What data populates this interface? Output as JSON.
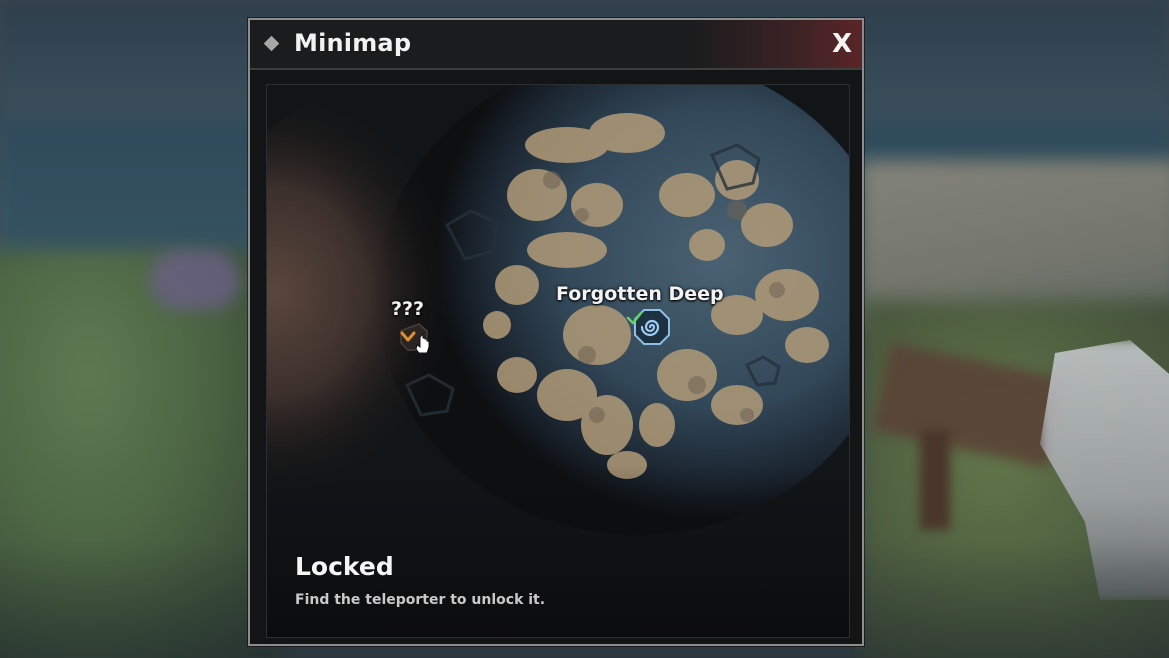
{
  "window": {
    "title": "Minimap",
    "close_label": "X"
  },
  "map": {
    "markers": [
      {
        "label": "???",
        "icon": "chevron-down-icon",
        "state": "locked",
        "color": "#e0902a"
      },
      {
        "label": "Forgotten Deep",
        "icon": "spiral-portal-icon",
        "state": "unlocked",
        "color": "#7fb6e6",
        "check_color": "#5fd06a"
      }
    ]
  },
  "info": {
    "title": "Locked",
    "description": "Find the teleporter to unlock it."
  },
  "colors": {
    "title_bar_accent": "#5a2528",
    "map_sand": "#b9a27e",
    "map_water": "#3e5668",
    "locked_region": "#4a3a35"
  }
}
